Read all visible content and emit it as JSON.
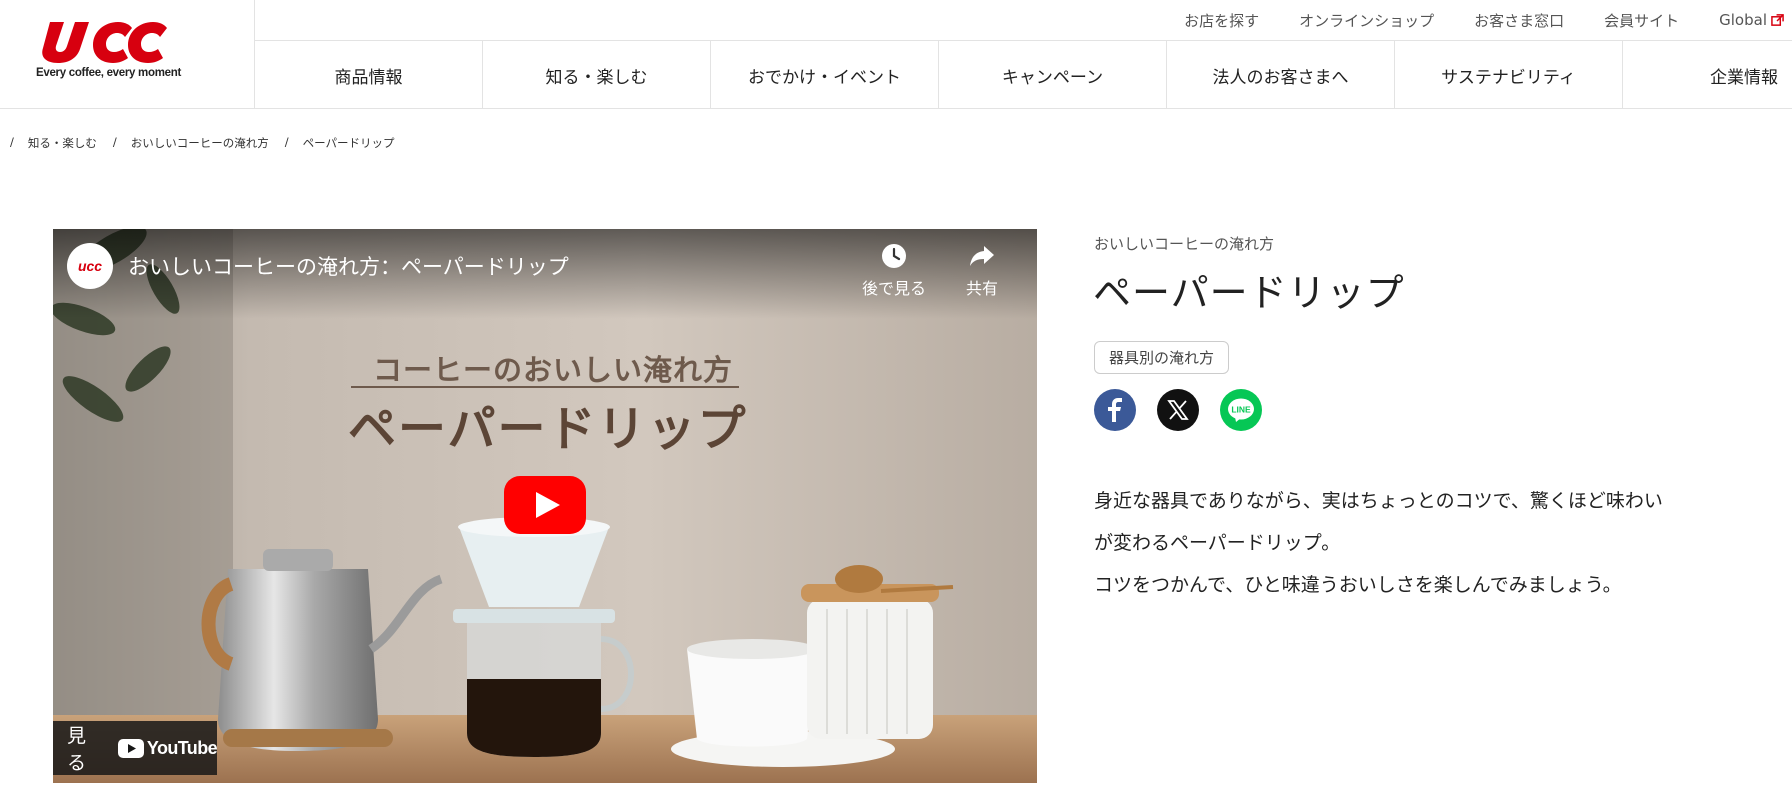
{
  "brand": {
    "logo_text": "UCC",
    "tagline": "Every coffee, every moment",
    "logo_color": "#d7000f"
  },
  "util_nav": [
    {
      "label": "お店を探す"
    },
    {
      "label": "オンラインショップ"
    },
    {
      "label": "お客さま窓口"
    },
    {
      "label": "会員サイト"
    },
    {
      "label": "Global",
      "icon": "external-link-icon"
    }
  ],
  "main_nav": [
    {
      "label": "商品情報"
    },
    {
      "label": "知る・楽しむ"
    },
    {
      "label": "おでかけ・イベント"
    },
    {
      "label": "キャンペーン"
    },
    {
      "label": "法人のお客さまへ"
    },
    {
      "label": "サステナビリティ"
    },
    {
      "label": "企業情報"
    }
  ],
  "breadcrumb": [
    {
      "label": "知る・楽しむ"
    },
    {
      "label": "おいしいコーヒーの淹れ方"
    },
    {
      "label": "ペーパードリップ"
    }
  ],
  "video": {
    "title": "おいしいコーヒーの淹れ方：ペーパードリップ",
    "watch_later": "後で見る",
    "share": "共有",
    "overlay_sub": "コーヒーのおいしい淹れ方",
    "overlay_main": "ペーパードリップ",
    "watch_on": "見る",
    "youtube": "YouTube",
    "play_color": "#ff0000"
  },
  "article": {
    "category": "おいしいコーヒーの淹れ方",
    "title": "ペーパードリップ",
    "tag": "器具別の淹れ方",
    "share_buttons": [
      {
        "name": "facebook",
        "icon": "facebook-icon",
        "color": "#3b5998"
      },
      {
        "name": "x",
        "icon": "x-icon",
        "color": "#111111"
      },
      {
        "name": "line",
        "icon": "line-icon",
        "color": "#06c755"
      }
    ],
    "description": [
      "身近な器具でありながら、実はちょっとのコツで、驚くほど味わい",
      "が変わるペーパードリップ。",
      "コツをつかんで、ひと味違うおいしさを楽しんでみましょう。"
    ]
  }
}
